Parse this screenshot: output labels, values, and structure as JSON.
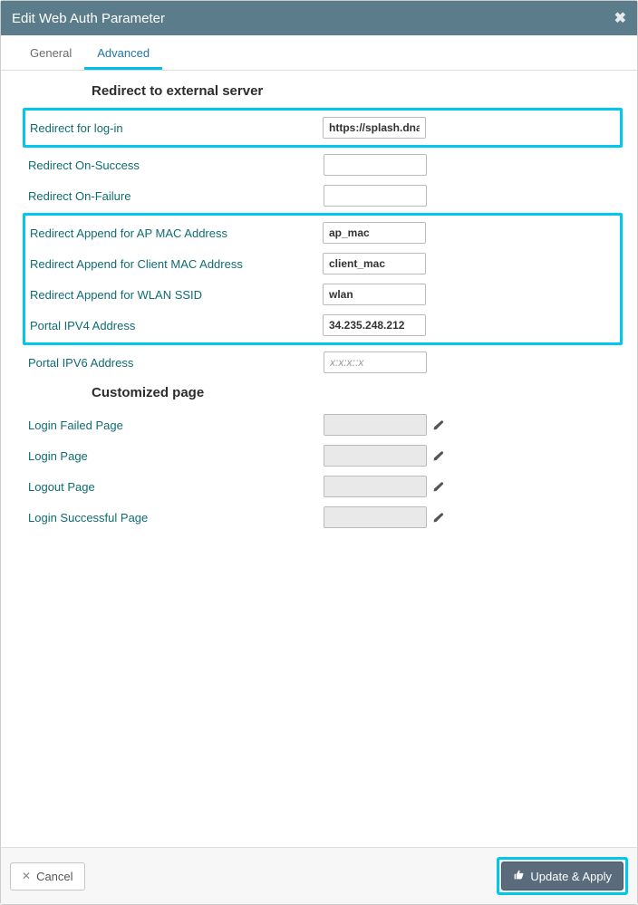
{
  "header": {
    "title": "Edit Web Auth Parameter",
    "close_glyph": "✖"
  },
  "tabs": {
    "general": "General",
    "advanced": "Advanced"
  },
  "sections": {
    "redirect_title": "Redirect to external server",
    "customized_title": "Customized page"
  },
  "fields": {
    "redirect_login": {
      "label": "Redirect for log-in",
      "value": "https://splash.dnasp"
    },
    "redirect_success": {
      "label": "Redirect On-Success",
      "value": ""
    },
    "redirect_failure": {
      "label": "Redirect On-Failure",
      "value": ""
    },
    "append_ap_mac": {
      "label": "Redirect Append for AP MAC Address",
      "value": "ap_mac"
    },
    "append_client_mac": {
      "label": "Redirect Append for Client MAC Address",
      "value": "client_mac"
    },
    "append_wlan_ssid": {
      "label": "Redirect Append for WLAN SSID",
      "value": "wlan"
    },
    "portal_ipv4": {
      "label": "Portal IPV4 Address",
      "value": "34.235.248.212"
    },
    "portal_ipv6": {
      "label": "Portal IPV6 Address",
      "value": "",
      "placeholder": "x:x:x::x"
    },
    "login_failed_page": {
      "label": "Login Failed Page",
      "value": ""
    },
    "login_page": {
      "label": "Login Page",
      "value": ""
    },
    "logout_page": {
      "label": "Logout Page",
      "value": ""
    },
    "login_success_page": {
      "label": "Login Successful Page",
      "value": ""
    }
  },
  "footer": {
    "cancel": "Cancel",
    "apply": "Update & Apply"
  }
}
